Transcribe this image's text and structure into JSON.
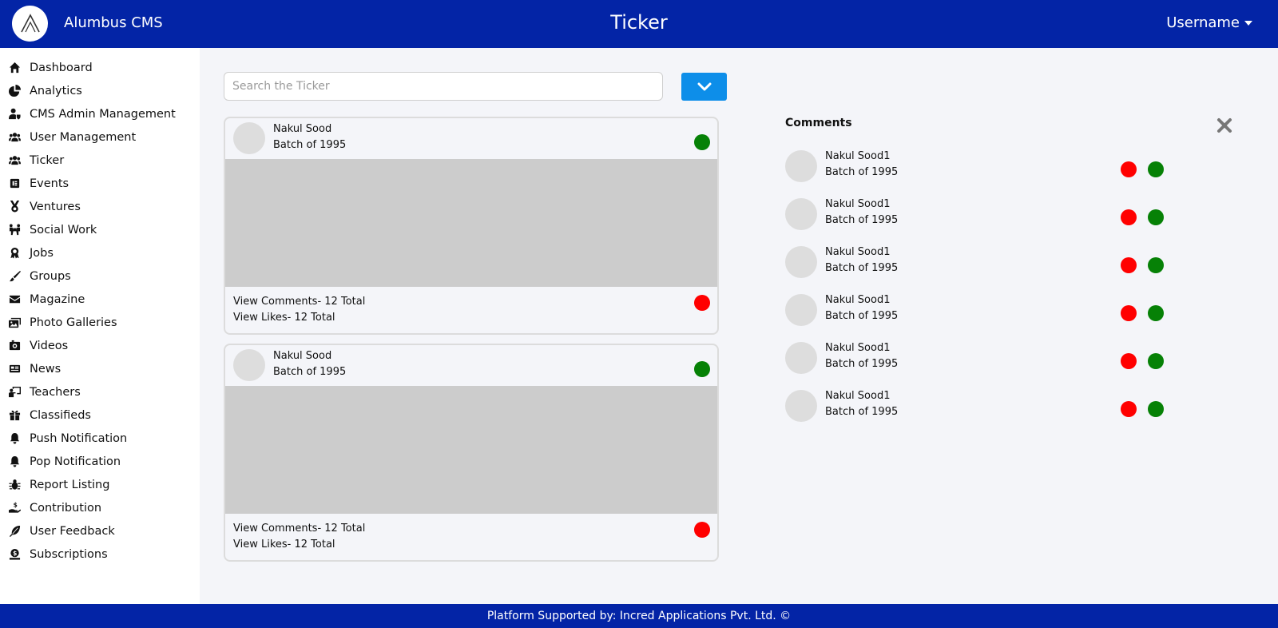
{
  "header": {
    "brand": "Alumbus CMS",
    "page_title": "Ticker",
    "username": "Username"
  },
  "sidebar": {
    "items": [
      {
        "label": "Dashboard",
        "icon": "home-icon"
      },
      {
        "label": "Analytics",
        "icon": "pie-chart-icon"
      },
      {
        "label": "CMS Admin Management",
        "icon": "user-shield-icon"
      },
      {
        "label": "User Management",
        "icon": "users-icon"
      },
      {
        "label": "Ticker",
        "icon": "users-icon"
      },
      {
        "label": "Events",
        "icon": "calendar-icon"
      },
      {
        "label": "Ventures",
        "icon": "medal-icon"
      },
      {
        "label": "Social Work",
        "icon": "people-carry-icon"
      },
      {
        "label": "Jobs",
        "icon": "award-icon"
      },
      {
        "label": "Groups",
        "icon": "brush-icon"
      },
      {
        "label": "Magazine",
        "icon": "envelope-icon"
      },
      {
        "label": "Photo Galleries",
        "icon": "images-icon"
      },
      {
        "label": "Videos",
        "icon": "video-icon"
      },
      {
        "label": "News",
        "icon": "newspaper-icon"
      },
      {
        "label": "Teachers",
        "icon": "chalkboard-teacher-icon"
      },
      {
        "label": "Classifieds",
        "icon": "gift-icon"
      },
      {
        "label": "Push Notification",
        "icon": "bell-icon"
      },
      {
        "label": "Pop Notification",
        "icon": "bell-icon"
      },
      {
        "label": "Report Listing",
        "icon": "bug-icon"
      },
      {
        "label": "Contribution",
        "icon": "hand-holding-usd-icon"
      },
      {
        "label": "User Feedback",
        "icon": "feather-icon"
      },
      {
        "label": "Subscriptions",
        "icon": "money-check-icon"
      }
    ]
  },
  "search": {
    "placeholder": "Search the Ticker",
    "value": ""
  },
  "posts": [
    {
      "name": "Nakul Sood",
      "batch": "Batch of 1995",
      "comments_link": "View Comments- 12 Total",
      "likes_link": "View Likes- 12 Total"
    },
    {
      "name": "Nakul Sood",
      "batch": "Batch of 1995",
      "comments_link": "View Comments- 12 Total",
      "likes_link": "View Likes- 12 Total"
    }
  ],
  "comments_panel": {
    "title": "Comments",
    "items": [
      {
        "name": "Nakul Sood1",
        "batch": "Batch of 1995"
      },
      {
        "name": "Nakul Sood1",
        "batch": "Batch of 1995"
      },
      {
        "name": "Nakul Sood1",
        "batch": "Batch of 1995"
      },
      {
        "name": "Nakul Sood1",
        "batch": "Batch of 1995"
      },
      {
        "name": "Nakul Sood1",
        "batch": "Batch of 1995"
      },
      {
        "name": "Nakul Sood1",
        "batch": "Batch of 1995"
      }
    ]
  },
  "footer": {
    "text": "Platform Supported by: Incred Applications Pvt. Ltd. ©"
  },
  "colors": {
    "header_bg": "#0324a6",
    "accent_button": "#0d8ee9",
    "approve": "#068106",
    "reject": "#ff0000"
  }
}
